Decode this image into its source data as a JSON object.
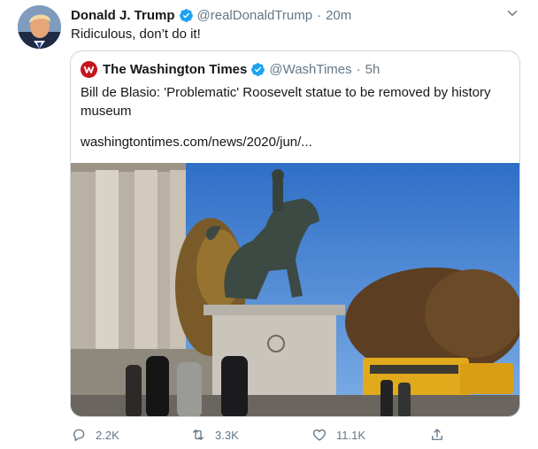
{
  "tweet": {
    "author_name": "Donald J. Trump",
    "handle": "@realDonaldTrump",
    "separator": "·",
    "time": "20m",
    "text": "Ridiculous, don’t do it!"
  },
  "quoted": {
    "author_name": "The Washington Times",
    "handle": "@WashTimes",
    "separator": "·",
    "time": "5h",
    "text": "Bill de Blasio: 'Problematic' Roosevelt statue to be removed by history museum",
    "link": "washingtontimes.com/news/2020/jun/..."
  },
  "actions": {
    "reply_count": "2.2K",
    "retweet_count": "3.3K",
    "like_count": "11.1K"
  },
  "colors": {
    "verified": "#1da1f2",
    "muted": "#657786",
    "border": "#ccd6dd",
    "washington_times_red": "#c4161c"
  },
  "icons": [
    "verified-badge-icon",
    "chevron-down-icon",
    "reply-icon",
    "retweet-icon",
    "like-icon",
    "share-icon"
  ]
}
